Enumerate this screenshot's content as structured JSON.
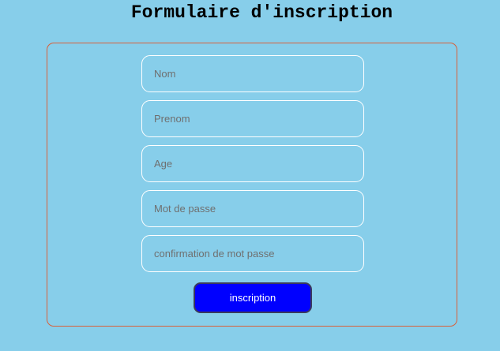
{
  "page": {
    "title": "Formulaire d'inscription"
  },
  "form": {
    "fields": [
      {
        "name": "nom",
        "placeholder": "Nom",
        "value": ""
      },
      {
        "name": "prenom",
        "placeholder": "Prenom",
        "value": ""
      },
      {
        "name": "age",
        "placeholder": "Age",
        "value": ""
      },
      {
        "name": "mot-de-passe",
        "placeholder": "Mot de passe",
        "value": ""
      },
      {
        "name": "confirmation",
        "placeholder": "confirmation de mot passe",
        "value": ""
      }
    ],
    "submit_label": "inscription"
  },
  "colors": {
    "background": "#87ceea",
    "panel_border": "#d9603a",
    "field_border": "#ffffff",
    "button_bg": "#0000ff",
    "button_text": "#ffffff"
  }
}
